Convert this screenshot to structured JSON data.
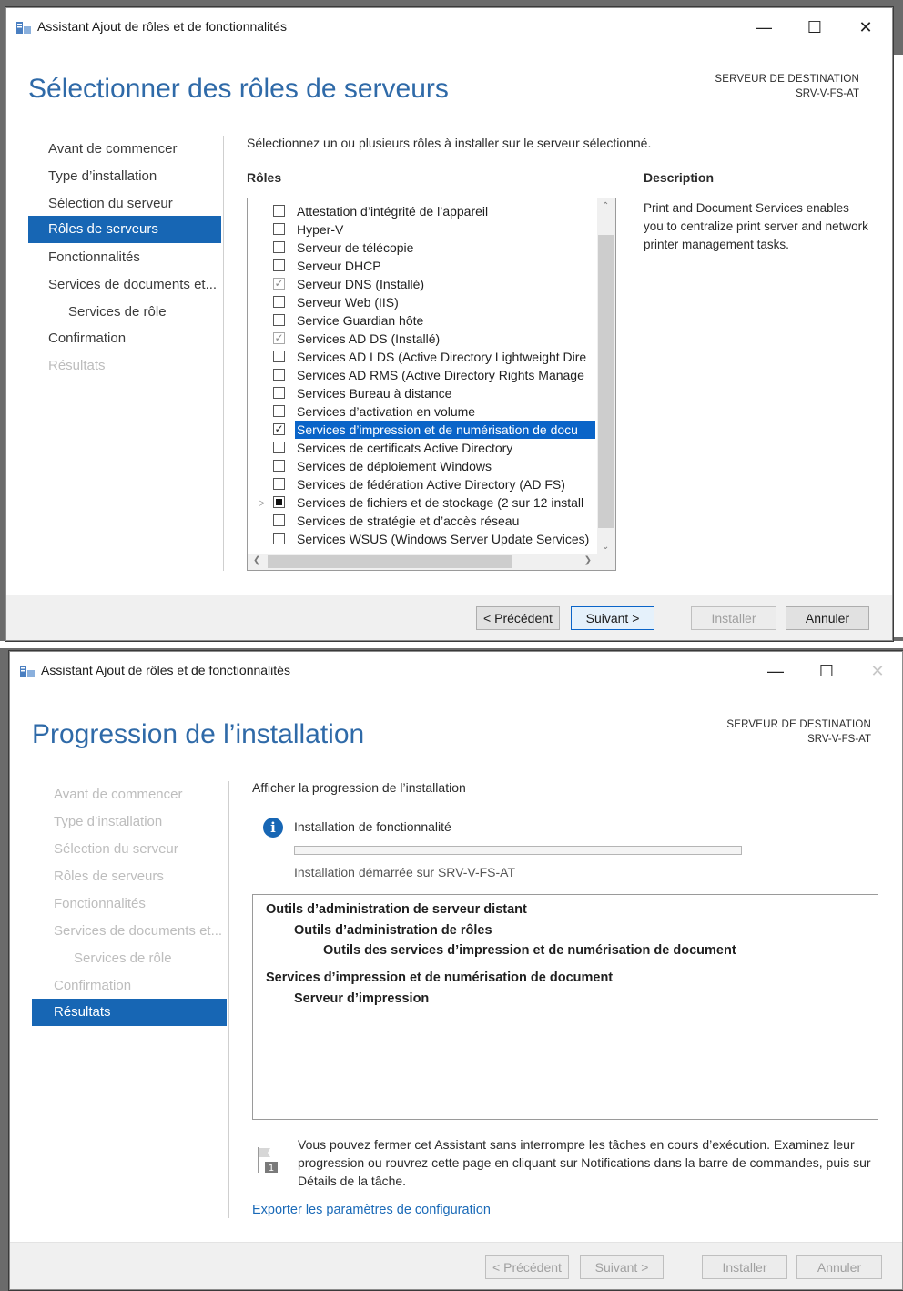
{
  "window1": {
    "title": "Assistant Ajout de rôles et de fonctionnalités",
    "page_title": "Sélectionner des rôles de serveurs",
    "destination_label": "SERVEUR DE DESTINATION",
    "destination_server": "SRV-V-FS-AT",
    "nav": [
      {
        "label": "Avant de commencer",
        "state": "normal"
      },
      {
        "label": "Type d’installation",
        "state": "normal"
      },
      {
        "label": "Sélection du serveur",
        "state": "normal"
      },
      {
        "label": "Rôles de serveurs",
        "state": "active"
      },
      {
        "label": "Fonctionnalités",
        "state": "normal"
      },
      {
        "label": "Services de documents et...",
        "state": "normal"
      },
      {
        "label": "Services de rôle",
        "state": "normal"
      },
      {
        "label": "Confirmation",
        "state": "normal"
      },
      {
        "label": "Résultats",
        "state": "disabled"
      }
    ],
    "instruction": "Sélectionnez un ou plusieurs rôles à installer sur le serveur sélectionné.",
    "roles_heading": "Rôles",
    "description_heading": "Description",
    "description_text": "Print and Document Services enables you to centralize print server and network printer management tasks.",
    "roles": [
      {
        "label": "Attestation d’intégrité de l’appareil",
        "check": "none"
      },
      {
        "label": "Hyper-V",
        "check": "none"
      },
      {
        "label": "Serveur de télécopie",
        "check": "none"
      },
      {
        "label": "Serveur DHCP",
        "check": "none"
      },
      {
        "label": "Serveur DNS (Installé)",
        "check": "installed"
      },
      {
        "label": "Serveur Web (IIS)",
        "check": "none"
      },
      {
        "label": "Service Guardian hôte",
        "check": "none"
      },
      {
        "label": "Services AD DS (Installé)",
        "check": "installed"
      },
      {
        "label": "Services AD LDS (Active Directory Lightweight Dire",
        "check": "none"
      },
      {
        "label": "Services AD RMS (Active Directory Rights Manage",
        "check": "none"
      },
      {
        "label": "Services Bureau à distance",
        "check": "none"
      },
      {
        "label": "Services d’activation en volume",
        "check": "none"
      },
      {
        "label": "Services d’impression et de numérisation de docu",
        "check": "checked",
        "selected": true
      },
      {
        "label": "Services de certificats Active Directory",
        "check": "none"
      },
      {
        "label": "Services de déploiement Windows",
        "check": "none"
      },
      {
        "label": "Services de fédération Active Directory (AD FS)",
        "check": "none"
      },
      {
        "label": "Services de fichiers et de stockage (2 sur 12 install",
        "check": "partial",
        "expandable": true
      },
      {
        "label": "Services de stratégie et d’accès réseau",
        "check": "none"
      },
      {
        "label": "Services WSUS (Windows Server Update Services)",
        "check": "none"
      }
    ],
    "buttons": {
      "previous": "< Précédent",
      "next": "Suivant >",
      "install": "Installer",
      "cancel": "Annuler"
    }
  },
  "window2": {
    "title": "Assistant Ajout de rôles et de fonctionnalités",
    "page_title": "Progression de l’installation",
    "destination_label": "SERVEUR DE DESTINATION",
    "destination_server": "SRV-V-FS-AT",
    "nav": [
      {
        "label": "Avant de commencer",
        "state": "disabled"
      },
      {
        "label": "Type d’installation",
        "state": "disabled"
      },
      {
        "label": "Sélection du serveur",
        "state": "disabled"
      },
      {
        "label": "Rôles de serveurs",
        "state": "disabled"
      },
      {
        "label": "Fonctionnalités",
        "state": "disabled"
      },
      {
        "label": "Services de documents et...",
        "state": "disabled"
      },
      {
        "label": "Services de rôle",
        "state": "disabled"
      },
      {
        "label": "Confirmation",
        "state": "disabled"
      },
      {
        "label": "Résultats",
        "state": "active"
      }
    ],
    "instruction": "Afficher la progression de l’installation",
    "status_title": "Installation de fonctionnalité",
    "progress": 0,
    "status_detail": "Installation démarrée sur SRV-V-FS-AT",
    "results": [
      {
        "text": "Outils d’administration de serveur distant",
        "level": 0
      },
      {
        "text": "Outils d’administration de rôles",
        "level": 1
      },
      {
        "text": "Outils des services d’impression et de numérisation de document",
        "level": 2
      },
      {
        "text": "Services d’impression et de numérisation de document",
        "level": 0
      },
      {
        "text": "Serveur d’impression",
        "level": 1
      }
    ],
    "note": "Vous pouvez fermer cet Assistant sans interrompre les tâches en cours d’exécution. Examinez leur progression ou rouvrez cette page en cliquant sur Notifications dans la barre de commandes, puis sur Détails de la tâche.",
    "notification_count": "1",
    "export_link": "Exporter les paramètres de configuration",
    "buttons": {
      "previous": "< Précédent",
      "next": "Suivant >",
      "install": "Installer",
      "cancel": "Annuler"
    }
  }
}
